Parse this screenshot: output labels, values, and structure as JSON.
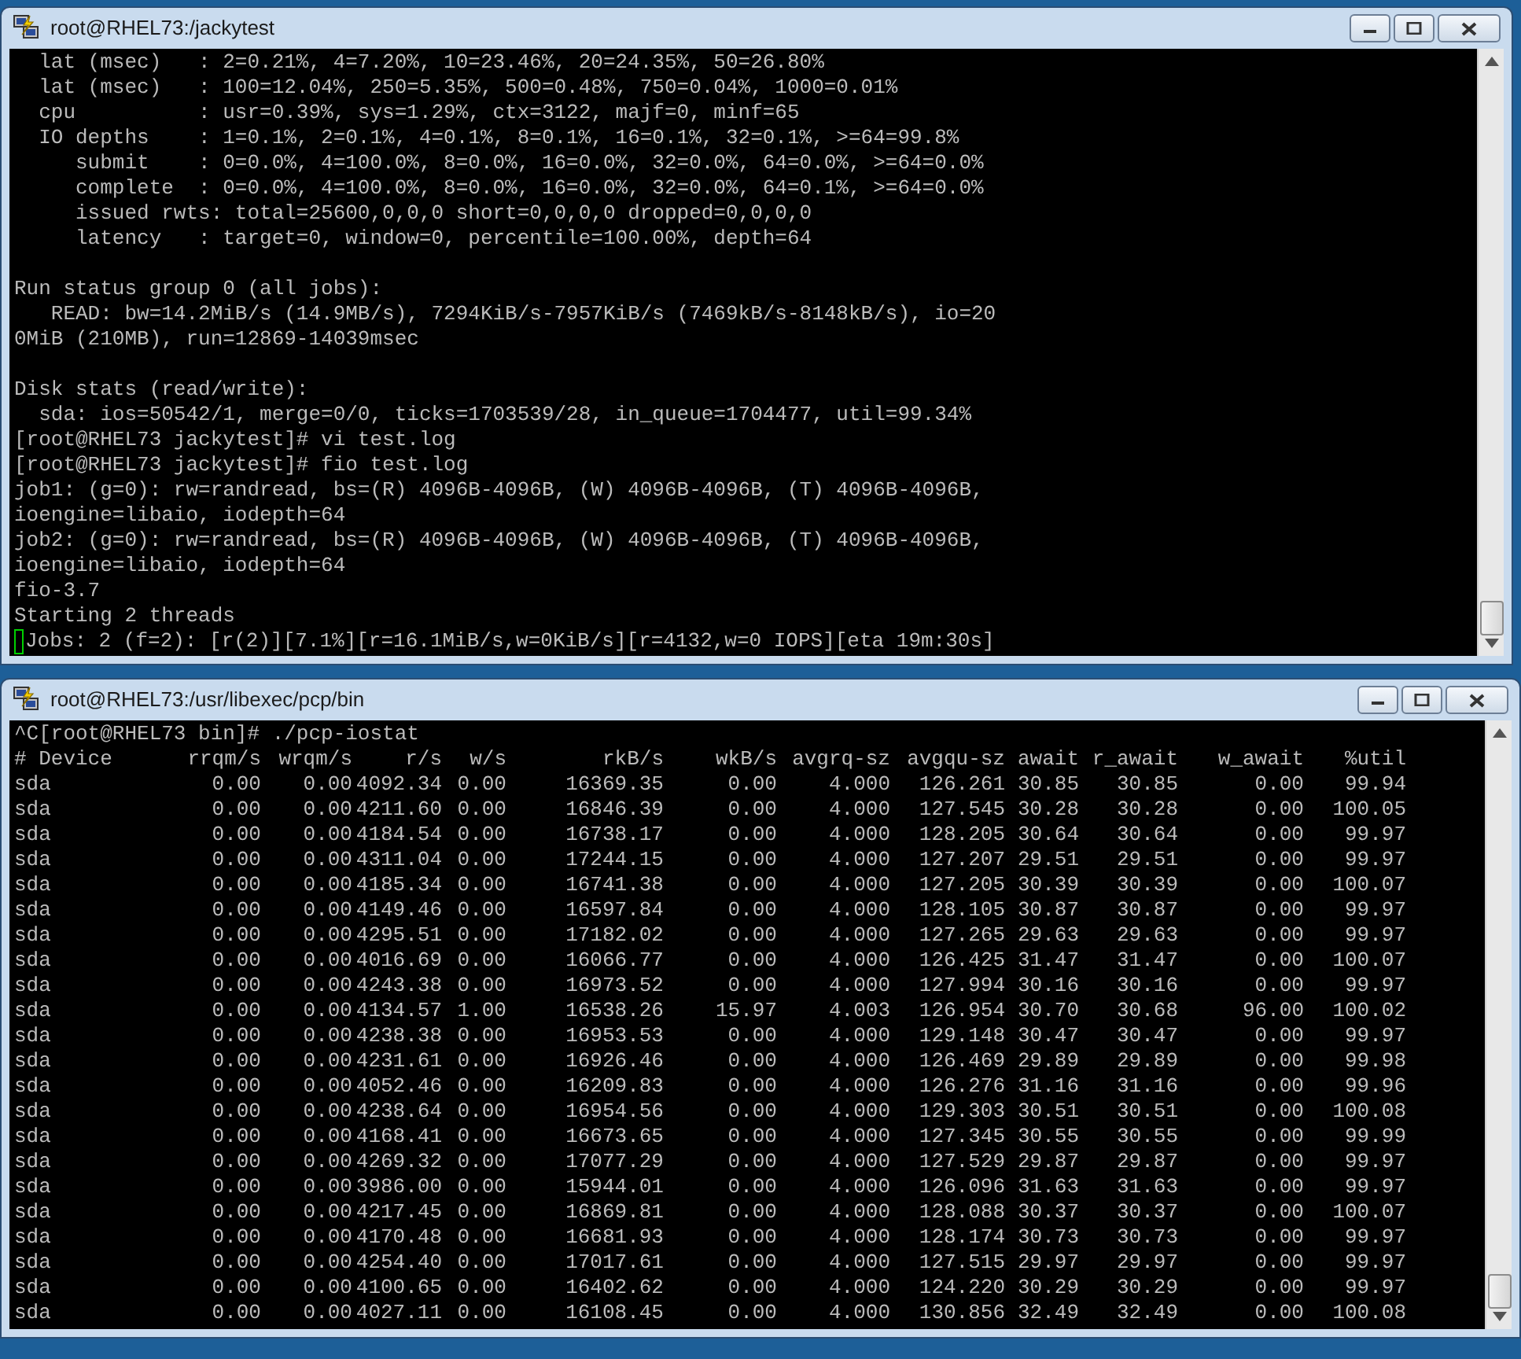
{
  "windows": [
    {
      "kind": "log",
      "title": "root@RHEL73:/jackytest",
      "blocks": [
        [
          "  lat (msec)   : 2=0.21%, 4=7.20%, 10=23.46%, 20=24.35%, 50=26.80%",
          "  lat (msec)   : 100=12.04%, 250=5.35%, 500=0.48%, 750=0.04%, 1000=0.01%",
          "  cpu          : usr=0.39%, sys=1.29%, ctx=3122, majf=0, minf=65",
          "  IO depths    : 1=0.1%, 2=0.1%, 4=0.1%, 8=0.1%, 16=0.1%, 32=0.1%, >=64=99.8%",
          "     submit    : 0=0.0%, 4=100.0%, 8=0.0%, 16=0.0%, 32=0.0%, 64=0.0%, >=64=0.0%",
          "     complete  : 0=0.0%, 4=100.0%, 8=0.0%, 16=0.0%, 32=0.0%, 64=0.1%, >=64=0.0%",
          "     issued rwts: total=25600,0,0,0 short=0,0,0,0 dropped=0,0,0,0",
          "     latency   : target=0, window=0, percentile=100.00%, depth=64"
        ],
        [
          "Run status group 0 (all jobs):",
          "   READ: bw=14.2MiB/s (14.9MB/s), 7294KiB/s-7957KiB/s (7469kB/s-8148kB/s), io=20",
          "0MiB (210MB), run=12869-14039msec"
        ],
        [
          "Disk stats (read/write):",
          "  sda: ios=50542/1, merge=0/0, ticks=1703539/28, in_queue=1704477, util=99.34%",
          "[root@RHEL73 jackytest]# vi test.log",
          "[root@RHEL73 jackytest]# fio test.log",
          "job1: (g=0): rw=randread, bs=(R) 4096B-4096B, (W) 4096B-4096B, (T) 4096B-4096B,",
          "ioengine=libaio, iodepth=64",
          "job2: (g=0): rw=randread, bs=(R) 4096B-4096B, (W) 4096B-4096B, (T) 4096B-4096B,",
          "ioengine=libaio, iodepth=64",
          "fio-3.7",
          "Starting 2 threads",
          "Jobs: 2 (f=2): [r(2)][7.1%][r=16.1MiB/s,w=0KiB/s][r=4132,w=0 IOPS][eta 19m:30s]"
        ]
      ]
    },
    {
      "kind": "table",
      "title": "root@RHEL73:/usr/libexec/pcp/bin",
      "command": "^C[root@RHEL73 bin]# ./pcp-iostat",
      "table": {
        "columns": [
          "# Device",
          "rrqm/s",
          "wrqm/s",
          "r/s",
          "w/s",
          "rkB/s",
          "wkB/s",
          "avgrq-sz",
          "avgqu-sz",
          "await",
          "r_await",
          "w_await",
          "%util"
        ],
        "rows": [
          [
            "sda",
            "0.00",
            "0.00",
            "4092.34",
            "0.00",
            "16369.35",
            "0.00",
            "4.000",
            "126.261",
            "30.85",
            "30.85",
            "0.00",
            "99.94"
          ],
          [
            "sda",
            "0.00",
            "0.00",
            "4211.60",
            "0.00",
            "16846.39",
            "0.00",
            "4.000",
            "127.545",
            "30.28",
            "30.28",
            "0.00",
            "100.05"
          ],
          [
            "sda",
            "0.00",
            "0.00",
            "4184.54",
            "0.00",
            "16738.17",
            "0.00",
            "4.000",
            "128.205",
            "30.64",
            "30.64",
            "0.00",
            "99.97"
          ],
          [
            "sda",
            "0.00",
            "0.00",
            "4311.04",
            "0.00",
            "17244.15",
            "0.00",
            "4.000",
            "127.207",
            "29.51",
            "29.51",
            "0.00",
            "99.97"
          ],
          [
            "sda",
            "0.00",
            "0.00",
            "4185.34",
            "0.00",
            "16741.38",
            "0.00",
            "4.000",
            "127.205",
            "30.39",
            "30.39",
            "0.00",
            "100.07"
          ],
          [
            "sda",
            "0.00",
            "0.00",
            "4149.46",
            "0.00",
            "16597.84",
            "0.00",
            "4.000",
            "128.105",
            "30.87",
            "30.87",
            "0.00",
            "99.97"
          ],
          [
            "sda",
            "0.00",
            "0.00",
            "4295.51",
            "0.00",
            "17182.02",
            "0.00",
            "4.000",
            "127.265",
            "29.63",
            "29.63",
            "0.00",
            "99.97"
          ],
          [
            "sda",
            "0.00",
            "0.00",
            "4016.69",
            "0.00",
            "16066.77",
            "0.00",
            "4.000",
            "126.425",
            "31.47",
            "31.47",
            "0.00",
            "100.07"
          ],
          [
            "sda",
            "0.00",
            "0.00",
            "4243.38",
            "0.00",
            "16973.52",
            "0.00",
            "4.000",
            "127.994",
            "30.16",
            "30.16",
            "0.00",
            "99.97"
          ],
          [
            "sda",
            "0.00",
            "0.00",
            "4134.57",
            "1.00",
            "16538.26",
            "15.97",
            "4.003",
            "126.954",
            "30.70",
            "30.68",
            "96.00",
            "100.02"
          ],
          [
            "sda",
            "0.00",
            "0.00",
            "4238.38",
            "0.00",
            "16953.53",
            "0.00",
            "4.000",
            "129.148",
            "30.47",
            "30.47",
            "0.00",
            "99.97"
          ],
          [
            "sda",
            "0.00",
            "0.00",
            "4231.61",
            "0.00",
            "16926.46",
            "0.00",
            "4.000",
            "126.469",
            "29.89",
            "29.89",
            "0.00",
            "99.98"
          ],
          [
            "sda",
            "0.00",
            "0.00",
            "4052.46",
            "0.00",
            "16209.83",
            "0.00",
            "4.000",
            "126.276",
            "31.16",
            "31.16",
            "0.00",
            "99.96"
          ],
          [
            "sda",
            "0.00",
            "0.00",
            "4238.64",
            "0.00",
            "16954.56",
            "0.00",
            "4.000",
            "129.303",
            "30.51",
            "30.51",
            "0.00",
            "100.08"
          ],
          [
            "sda",
            "0.00",
            "0.00",
            "4168.41",
            "0.00",
            "16673.65",
            "0.00",
            "4.000",
            "127.345",
            "30.55",
            "30.55",
            "0.00",
            "99.99"
          ],
          [
            "sda",
            "0.00",
            "0.00",
            "4269.32",
            "0.00",
            "17077.29",
            "0.00",
            "4.000",
            "127.529",
            "29.87",
            "29.87",
            "0.00",
            "99.97"
          ],
          [
            "sda",
            "0.00",
            "0.00",
            "3986.00",
            "0.00",
            "15944.01",
            "0.00",
            "4.000",
            "126.096",
            "31.63",
            "31.63",
            "0.00",
            "99.97"
          ],
          [
            "sda",
            "0.00",
            "0.00",
            "4217.45",
            "0.00",
            "16869.81",
            "0.00",
            "4.000",
            "128.088",
            "30.37",
            "30.37",
            "0.00",
            "100.07"
          ],
          [
            "sda",
            "0.00",
            "0.00",
            "4170.48",
            "0.00",
            "16681.93",
            "0.00",
            "4.000",
            "128.174",
            "30.73",
            "30.73",
            "0.00",
            "99.97"
          ],
          [
            "sda",
            "0.00",
            "0.00",
            "4254.40",
            "0.00",
            "17017.61",
            "0.00",
            "4.000",
            "127.515",
            "29.97",
            "29.97",
            "0.00",
            "99.97"
          ],
          [
            "sda",
            "0.00",
            "0.00",
            "4100.65",
            "0.00",
            "16402.62",
            "0.00",
            "4.000",
            "124.220",
            "30.29",
            "30.29",
            "0.00",
            "99.97"
          ],
          [
            "sda",
            "0.00",
            "0.00",
            "4027.11",
            "0.00",
            "16108.45",
            "0.00",
            "4.000",
            "130.856",
            "32.49",
            "32.49",
            "0.00",
            "100.08"
          ]
        ]
      }
    }
  ]
}
